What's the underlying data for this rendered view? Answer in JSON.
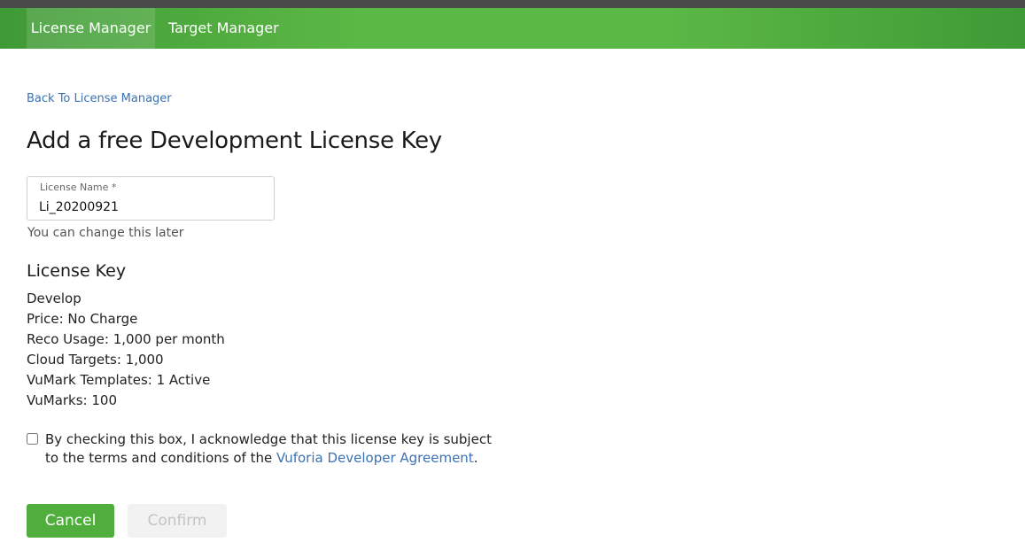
{
  "nav": {
    "tabs": [
      {
        "label": "License Manager",
        "active": true
      },
      {
        "label": "Target Manager",
        "active": false
      }
    ],
    "accent": "#5cb845"
  },
  "back_link": "Back To License Manager",
  "title": "Add a free Development License Key",
  "license_name_field": {
    "label": "License Name *",
    "value": "Li_20200921",
    "helper": "You can change this later"
  },
  "license_key": {
    "heading": "License Key",
    "details": [
      "Develop",
      "Price: No Charge",
      "Reco Usage: 1,000 per month",
      "Cloud Targets: 1,000",
      "VuMark Templates: 1 Active",
      "VuMarks: 100"
    ]
  },
  "agreement": {
    "text_before": "By checking this box, I acknowledge that this license key is subject to the terms and conditions of the ",
    "link_text": "Vuforia Developer Agreement",
    "text_after": ".",
    "checked": false
  },
  "buttons": {
    "cancel": "Cancel",
    "confirm": "Confirm"
  }
}
